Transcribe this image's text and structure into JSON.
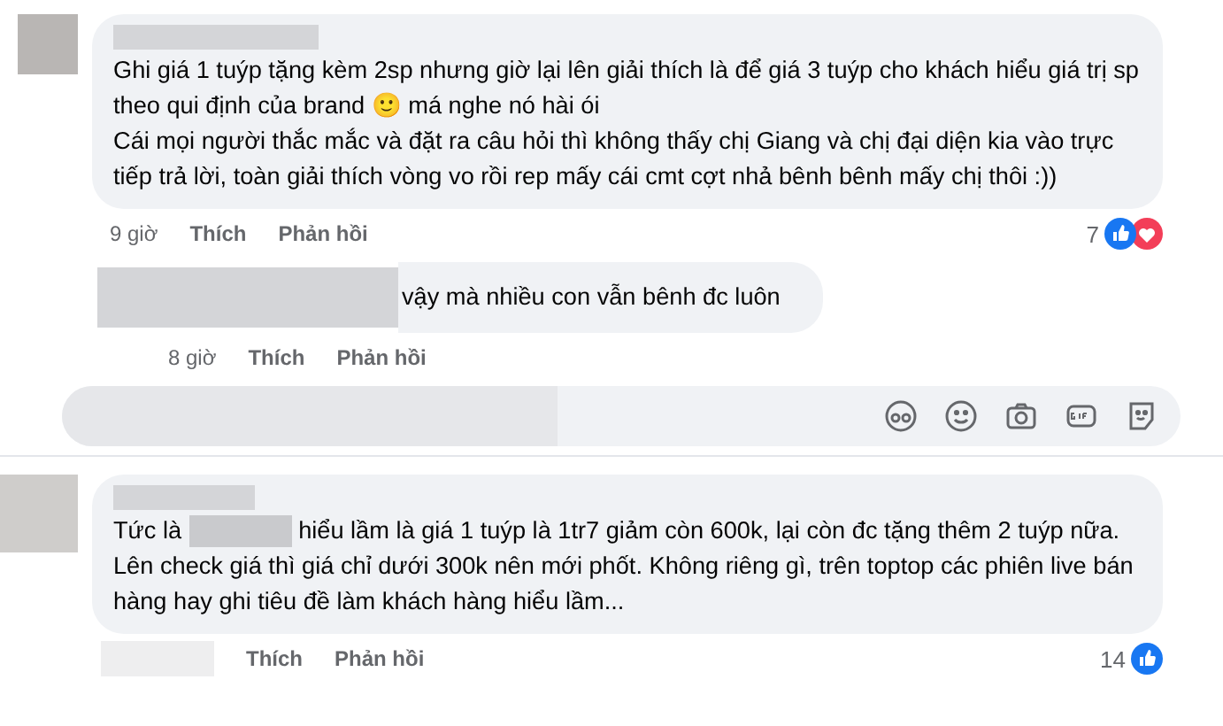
{
  "comments": [
    {
      "paragraphs": [
        "Ghi giá 1 tuýp tặng kèm 2sp nhưng giờ lại lên giải thích là để giá 3 tuýp cho khách hiểu giá trị sp theo qui định của brand 🙂 má nghe nó hài ói",
        "Cái mọi người thắc mắc và đặt ra câu hỏi thì không thấy chị Giang và chị đại diện kia vào trực tiếp trả lời, toàn giải thích vòng vo rồi rep mấy cái cmt cợt nhả bênh bênh mấy chị thôi :))"
      ],
      "time": "9 giờ",
      "like": "Thích",
      "reply": "Phản hồi",
      "reaction_count": "7",
      "reactions": [
        {
          "kind": "like"
        },
        {
          "kind": "love"
        }
      ],
      "replies": [
        {
          "text": "vậy mà nhiều con vẫn bênh đc luôn",
          "time": "8 giờ",
          "like": "Thích",
          "reply": "Phản hồi"
        }
      ]
    },
    {
      "text_start": "Tức là",
      "text_end": "hiểu lầm là giá 1 tuýp là 1tr7 giảm còn 600k, lại còn đc tặng thêm 2 tuýp nữa. Lên check giá thì giá chỉ dưới 300k nên mới phốt. Không riêng gì, trên toptop các phiên live bán hàng hay ghi tiêu đề làm khách hàng hiểu lầm...",
      "like": "Thích",
      "reply": "Phản hồi",
      "reaction_count": "14",
      "reactions": [
        {
          "kind": "like"
        }
      ]
    }
  ]
}
